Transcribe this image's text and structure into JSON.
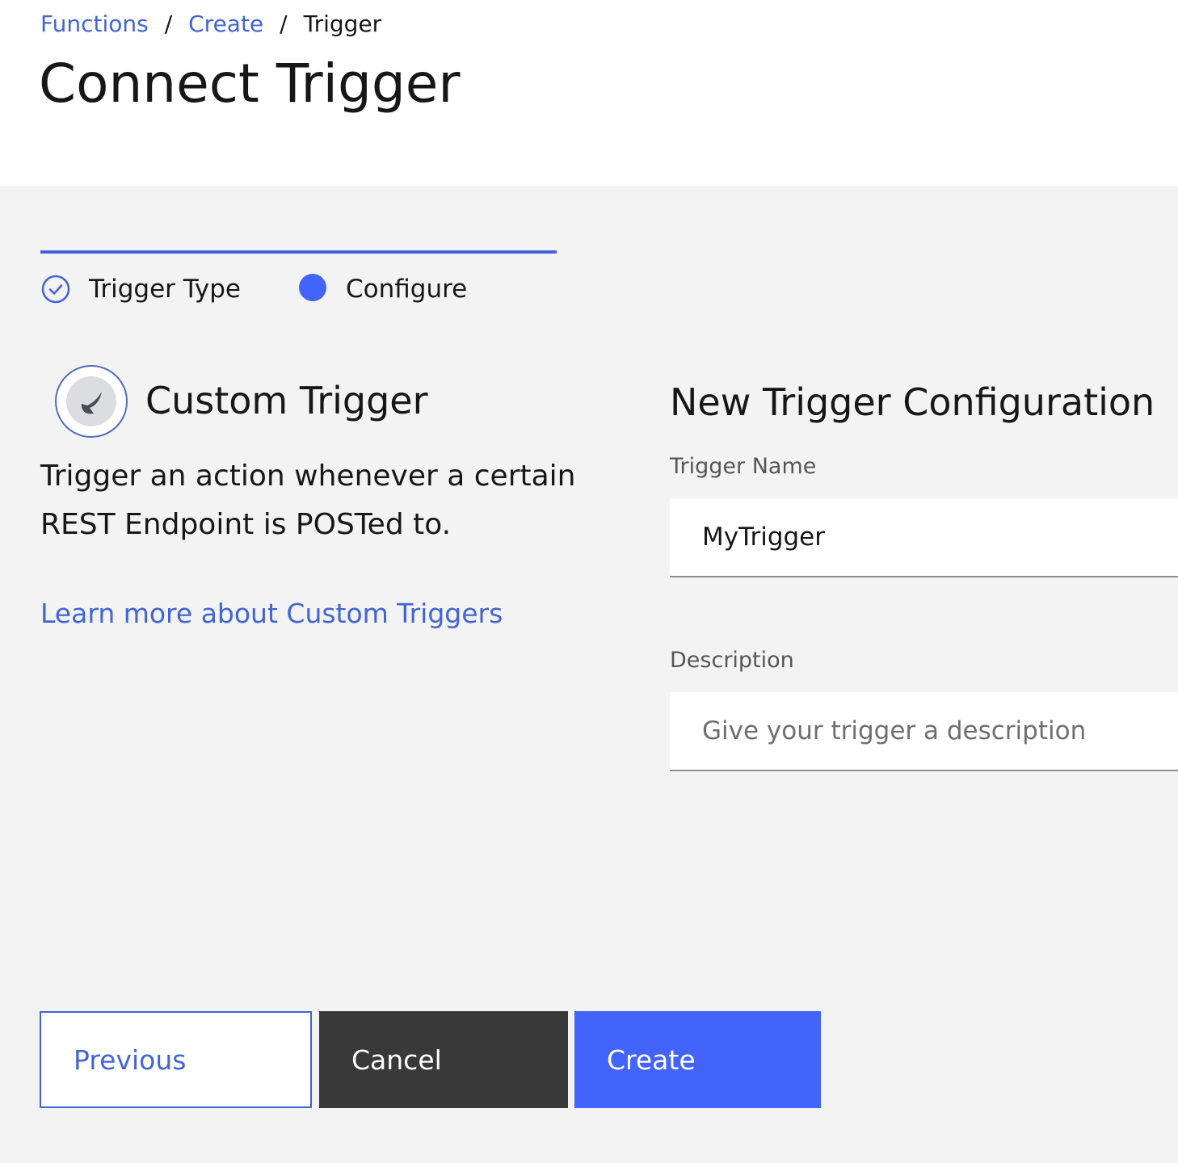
{
  "breadcrumb": {
    "items": [
      {
        "label": "Functions"
      },
      {
        "label": "Create"
      },
      {
        "label": "Trigger"
      }
    ],
    "separator": "/"
  },
  "page_title": "Connect Trigger",
  "progress": {
    "steps": [
      {
        "label": "Trigger Type",
        "status": "complete",
        "icon": "checkmark-circle-icon"
      },
      {
        "label": "Configure",
        "status": "current",
        "icon": "filled-circle-icon"
      }
    ]
  },
  "trigger": {
    "title": "Custom Trigger",
    "icon": "custom-trigger-icon",
    "description": "Trigger an action whenever a certain REST Endpoint is POSTed to.",
    "learn_more": "Learn more about Custom Triggers"
  },
  "config": {
    "title": "New Trigger Configuration",
    "fields": {
      "name": {
        "label": "Trigger Name",
        "value": "MyTrigger"
      },
      "description": {
        "label": "Description",
        "value": "",
        "placeholder": "Give your trigger a description"
      }
    }
  },
  "buttons": {
    "previous": "Previous",
    "cancel": "Cancel",
    "create": "Create"
  },
  "colors": {
    "accent": "#4264fb",
    "link": "#4264d4",
    "dark_button": "#393939",
    "background": "#f3f3f3"
  }
}
